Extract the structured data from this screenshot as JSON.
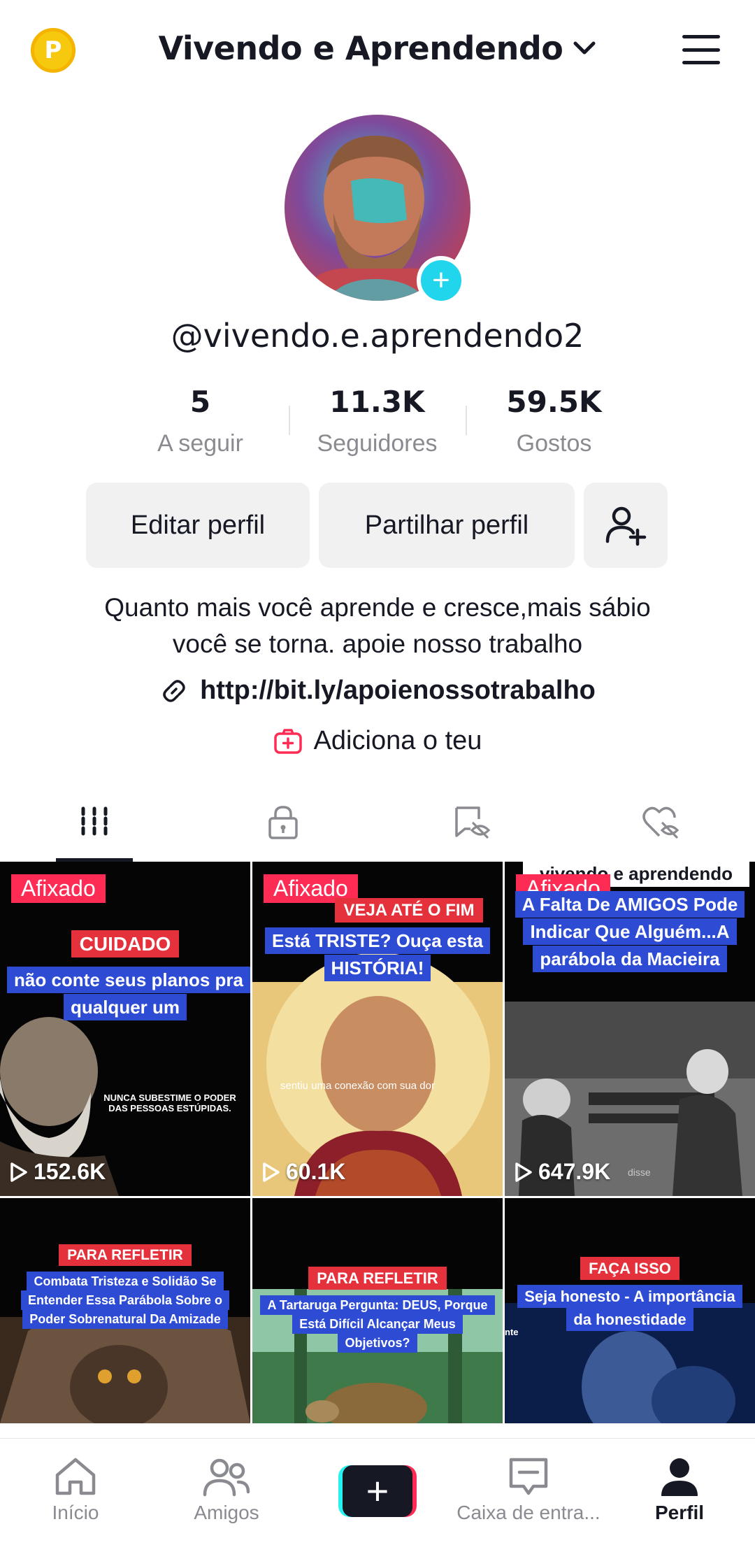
{
  "header": {
    "coin_letter": "P",
    "title": "Vivendo e Aprendendo"
  },
  "profile": {
    "handle": "@vivendo.e.aprendendo2",
    "stats": [
      {
        "value": "5",
        "label": "A seguir"
      },
      {
        "value": "11.3K",
        "label": "Seguidores"
      },
      {
        "value": "59.5K",
        "label": "Gostos"
      }
    ],
    "buttons": {
      "edit": "Editar perfil",
      "share": "Partilhar perfil"
    },
    "bio_line1": "Quanto mais você aprende e cresce,mais sábio",
    "bio_line2": "você se torna. apoie nosso trabalho",
    "link": "http://bit.ly/apoienossotrabalho",
    "add_yours": "Adiciona o teu"
  },
  "tabs": [
    "videos-tab",
    "private-tab",
    "reposts-tab",
    "liked-tab"
  ],
  "videos": [
    {
      "pinned": "Afixado",
      "red_caption": "CUIDADO",
      "blue_caption": "não conte seus planos pra qualquer um",
      "note": "NUNCA SUBESTIME O PODER DAS PESSOAS ESTÚPIDAS.",
      "views": "152.6K"
    },
    {
      "pinned": "Afixado",
      "red_caption": "VEJA ATÉ O FIM",
      "blue_caption": "Está TRISTE? Ouça esta HISTÓRIA!",
      "note": "sentiu uma conexão com sua dor",
      "views": "60.1K"
    },
    {
      "pinned": "Afixado",
      "top_label": "vivendo e aprendendo",
      "blue_caption": "A Falta De AMIGOS Pode Indicar Que Alguém...A parábola da Macieira",
      "note": "disse",
      "views": "647.9K"
    },
    {
      "red_caption": "PARA REFLETIR",
      "blue_caption": "Combata Tristeza e Solidão Se Entender Essa Parábola Sobre o Poder Sobrenatural Da Amizade"
    },
    {
      "red_caption": "PARA REFLETIR",
      "blue_caption": "A Tartaruga Pergunta: DEUS, Porque Está Difícil Alcançar Meus Objetivos?"
    },
    {
      "red_caption": "FAÇA ISSO",
      "blue_caption": "Seja honesto - A importância da honestidade",
      "note": "nte"
    }
  ],
  "nav": [
    {
      "label": "Início",
      "icon": "home-icon"
    },
    {
      "label": "Amigos",
      "icon": "friends-icon"
    },
    {
      "label": "",
      "icon": "create-icon"
    },
    {
      "label": "Caixa de entra...",
      "icon": "inbox-icon"
    },
    {
      "label": "Perfil",
      "icon": "profile-icon"
    }
  ],
  "colors": {
    "accent": "#fe2c55",
    "cyan": "#25f4ee",
    "text": "#161823",
    "muted": "#8a8b91"
  }
}
